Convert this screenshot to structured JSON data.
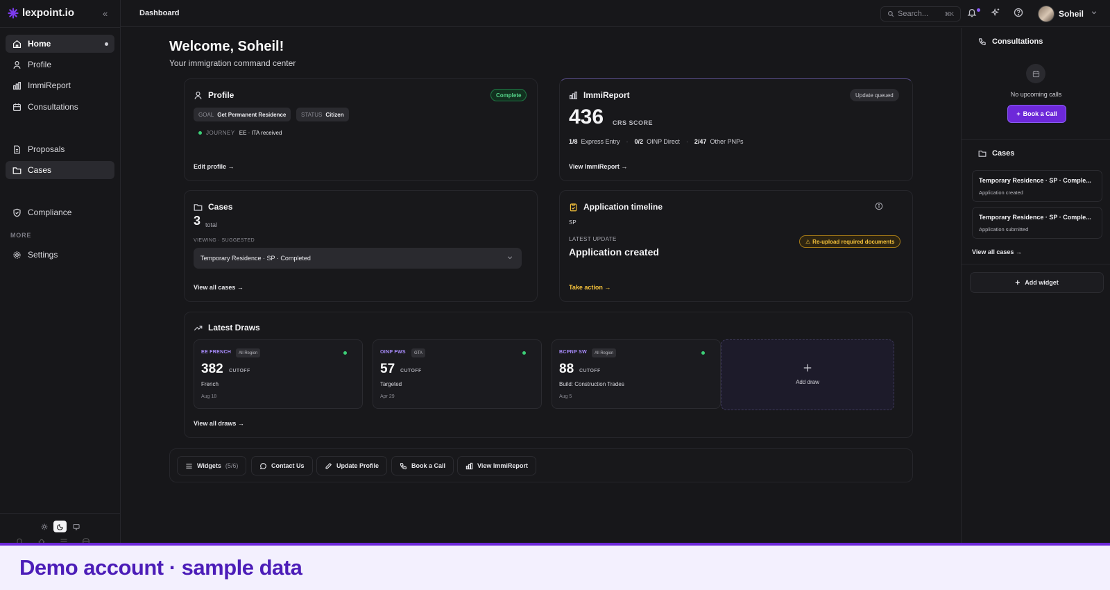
{
  "app": {
    "name": "lexpoint.io"
  },
  "sidebar": {
    "items": [
      {
        "label": "Home"
      },
      {
        "label": "Profile"
      },
      {
        "label": "ImmiReport"
      },
      {
        "label": "Consultations"
      },
      {
        "label": "Proposals"
      },
      {
        "label": "Cases"
      },
      {
        "label": "Compliance"
      }
    ],
    "section_more": "MORE",
    "settings_label": "Settings"
  },
  "topbar": {
    "breadcrumb": "Dashboard",
    "search_placeholder": "Search...",
    "search_shortcut": "⌘K",
    "user_name": "Soheil"
  },
  "welcome": {
    "title": "Welcome, Soheil!",
    "subtitle": "Your immigration command center"
  },
  "profile_card": {
    "title": "Profile",
    "status_badge": "Complete",
    "goal_key": "GOAL",
    "goal_value": "Get Permanent Residence",
    "status_key": "STATUS",
    "status_value": "Citizen",
    "journey_key": "JOURNEY",
    "journey_value": "EE · ITA received",
    "link": "Edit profile →"
  },
  "immireport_card": {
    "title": "ImmiReport",
    "badge": "Update queued",
    "score": "436",
    "score_unit": "CRS SCORE",
    "stat1_value": "1/8",
    "stat1_label": "Express Entry",
    "stat2_value": "0/2",
    "stat2_label": "OINP Direct",
    "stat3_value": "2/47",
    "stat3_label": "Other PNPs",
    "separator": "·",
    "link": "View ImmiReport →"
  },
  "cases_card": {
    "title": "Cases",
    "count": "3",
    "count_unit": "total",
    "viewing_label": "VIEWING · SUGGESTED",
    "selected_case": "Temporary Residence · SP · Completed",
    "link": "View all cases →"
  },
  "timeline_card": {
    "title": "Application timeline",
    "program": "SP",
    "latest_label": "LATEST UPDATE",
    "latest_value": "Application created",
    "warning": "Re-upload required documents",
    "link": "Take action →"
  },
  "draws_card": {
    "title": "Latest Draws",
    "draws": [
      {
        "code": "EE FRENCH",
        "tag": "All Region",
        "score": "382",
        "unit": "CUTOFF",
        "description": "French",
        "date": "Aug 18"
      },
      {
        "code": "OINP FWS",
        "tag": "GTA",
        "score": "57",
        "unit": "CUTOFF",
        "description": "Targeted",
        "date": "Apr 29"
      },
      {
        "code": "BCPNP SW",
        "tag": "All Region",
        "score": "88",
        "unit": "CUTOFF",
        "description": "Build: Construction Trades",
        "date": "Aug 5"
      }
    ],
    "add_draw": "Add draw",
    "link": "View all draws →"
  },
  "actions": {
    "widgets_label": "Widgets",
    "widgets_count": "(5/6)",
    "contact": "Contact Us",
    "update_profile": "Update Profile",
    "book_call": "Book a Call",
    "view_report": "View ImmiReport"
  },
  "right_panel": {
    "consultations_title": "Consultations",
    "no_calls": "No upcoming calls",
    "book_button": "Book a Call",
    "cases_title": "Cases",
    "cases": [
      {
        "title": "Temporary Residence · SP · Comple...",
        "status": "Application created"
      },
      {
        "title": "Temporary Residence · SP · Comple...",
        "status": "Application submitted"
      }
    ],
    "view_all_cases": "View all cases →",
    "add_widget": "Add widget"
  },
  "banner": {
    "text": "Demo account · sample data"
  },
  "colors": {
    "accent": "#6d28d9",
    "success": "#3ccf77",
    "warning": "#f3c03b",
    "background": "#17171a"
  }
}
